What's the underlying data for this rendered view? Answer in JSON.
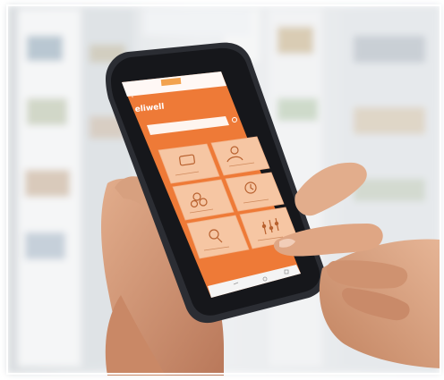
{
  "scene": {
    "description_tag": "store-aisle-photo",
    "colors": {
      "accent": "#ee6e2a",
      "tile_bg": "#f6c6a3",
      "tile_border": "#f3b38a",
      "screen_bg": "#ee7a37",
      "phone_body": "#2b2d33",
      "skin": "#d49b79",
      "background": "#e9ecef"
    }
  },
  "app": {
    "brand": "eliwell",
    "status_bar": "",
    "search_placeholder": "",
    "tiles": [
      {
        "icon": "monitor-icon",
        "label": ""
      },
      {
        "icon": "user-icon",
        "label": ""
      },
      {
        "icon": "coins-icon",
        "label": ""
      },
      {
        "icon": "clock-icon",
        "label": ""
      },
      {
        "icon": "magnifier-icon",
        "label": ""
      },
      {
        "icon": "sliders-icon",
        "label": ""
      }
    ]
  }
}
